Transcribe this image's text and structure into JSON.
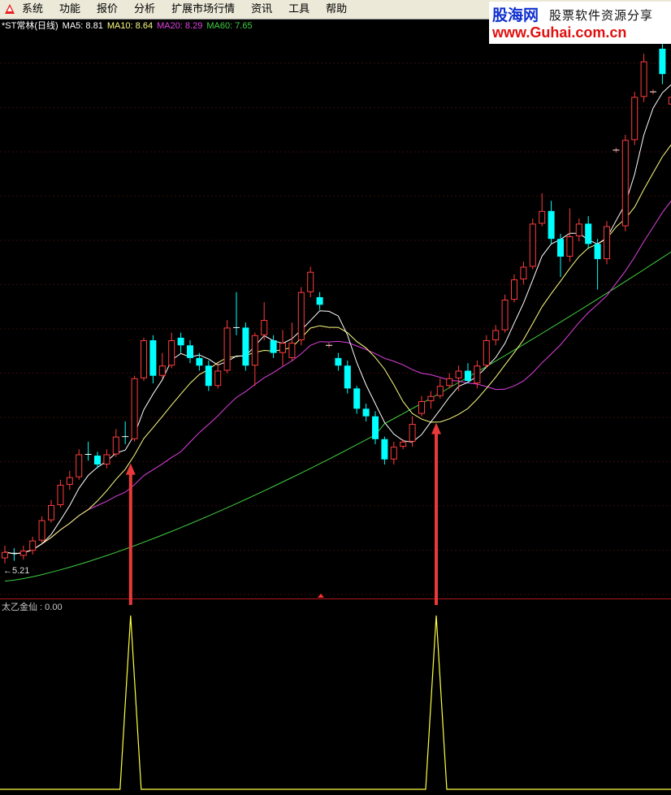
{
  "menubar": {
    "items": [
      "系统",
      "功能",
      "报价",
      "分析",
      "扩展市场行情",
      "资讯",
      "工具",
      "帮助"
    ]
  },
  "brand": {
    "name": "股海网",
    "tagline": "股票软件资源分享",
    "url": "www.Guhai.com.cn"
  },
  "legend": {
    "title": "*ST常林(日线)",
    "ma5": "MA5: 8.81",
    "ma10": "MA10: 8.64",
    "ma20": "MA20: 8.29",
    "ma60": "MA60: 7.65"
  },
  "colors": {
    "up": "#ff3d3d",
    "down": "#00ffff",
    "ma5": "#ffffff",
    "ma10": "#ffff80",
    "ma20": "#e040e0",
    "ma60": "#40d040",
    "signal": "#ffff40",
    "arrow": "#e83a3a"
  },
  "price_low_label": "5.21",
  "indicator": {
    "label": "太乙金仙 : 0.00",
    "value": 0.0
  },
  "chart_data": {
    "type": "candlestick",
    "title": "*ST常林(日线)",
    "y_range_visible": [
      5.0,
      9.3
    ],
    "lowest_marked": 5.21,
    "moving_averages": [
      {
        "name": "MA5",
        "last": 8.81
      },
      {
        "name": "MA10",
        "last": 8.64
      },
      {
        "name": "MA20",
        "last": 8.29
      },
      {
        "name": "MA60",
        "last": 7.65
      }
    ],
    "candles": [
      [
        5.28,
        5.33,
        5.38,
        5.24
      ],
      [
        5.32,
        5.3,
        5.36,
        5.26
      ],
      [
        5.3,
        5.34,
        5.38,
        5.27
      ],
      [
        5.34,
        5.42,
        5.45,
        5.31
      ],
      [
        5.42,
        5.58,
        5.61,
        5.4
      ],
      [
        5.58,
        5.7,
        5.74,
        5.56
      ],
      [
        5.7,
        5.86,
        5.9,
        5.68
      ],
      [
        5.86,
        5.92,
        5.97,
        5.82
      ],
      [
        5.92,
        6.1,
        6.14,
        5.9
      ],
      [
        6.1,
        6.09,
        6.2,
        6.05
      ],
      [
        6.09,
        6.02,
        6.12,
        5.99
      ],
      [
        6.02,
        6.1,
        6.14,
        5.99
      ],
      [
        6.1,
        6.24,
        6.3,
        6.08
      ],
      [
        6.24,
        6.22,
        6.36,
        6.18
      ],
      [
        6.22,
        6.7,
        6.72,
        6.2
      ],
      [
        6.7,
        7.0,
        7.02,
        6.68
      ],
      [
        7.0,
        6.72,
        7.04,
        6.66
      ],
      [
        6.72,
        6.8,
        6.9,
        6.7
      ],
      [
        6.8,
        7.0,
        7.06,
        6.78
      ],
      [
        7.02,
        6.96,
        7.06,
        6.9
      ],
      [
        6.96,
        6.86,
        7.0,
        6.82
      ],
      [
        6.86,
        6.8,
        6.9,
        6.76
      ],
      [
        6.8,
        6.64,
        6.84,
        6.6
      ],
      [
        6.64,
        6.76,
        6.82,
        6.62
      ],
      [
        6.76,
        7.1,
        7.16,
        6.74
      ],
      [
        7.1,
        7.08,
        7.38,
        7.04
      ],
      [
        7.1,
        6.8,
        7.14,
        6.76
      ],
      [
        6.8,
        7.04,
        7.06,
        6.64
      ],
      [
        7.04,
        7.16,
        7.3,
        7.0
      ],
      [
        7.0,
        6.9,
        7.04,
        6.86
      ],
      [
        6.9,
        6.98,
        7.08,
        6.8
      ],
      [
        6.86,
        6.98,
        7.14,
        6.84
      ],
      [
        7.0,
        7.38,
        7.42,
        6.96
      ],
      [
        7.38,
        7.54,
        7.58,
        7.34
      ],
      [
        7.34,
        7.28,
        7.38,
        7.24
      ],
      [
        6.96,
        6.96,
        6.98,
        6.94
      ],
      [
        6.86,
        6.8,
        6.9,
        6.76
      ],
      [
        6.8,
        6.62,
        6.84,
        6.58
      ],
      [
        6.62,
        6.46,
        6.64,
        6.42
      ],
      [
        6.46,
        6.4,
        6.5,
        6.36
      ],
      [
        6.4,
        6.22,
        6.44,
        6.18
      ],
      [
        6.22,
        6.06,
        6.24,
        6.02
      ],
      [
        6.06,
        6.16,
        6.2,
        6.02
      ],
      [
        6.16,
        6.2,
        6.22,
        6.14
      ],
      [
        6.2,
        6.34,
        6.4,
        6.16
      ],
      [
        6.42,
        6.52,
        6.56,
        6.4
      ],
      [
        6.52,
        6.56,
        6.6,
        6.46
      ],
      [
        6.56,
        6.64,
        6.7,
        6.54
      ],
      [
        6.64,
        6.7,
        6.74,
        6.62
      ],
      [
        6.7,
        6.76,
        6.8,
        6.6
      ],
      [
        6.76,
        6.68,
        6.82,
        6.66
      ],
      [
        6.66,
        6.8,
        6.84,
        6.62
      ],
      [
        6.8,
        7.0,
        7.04,
        6.78
      ],
      [
        7.0,
        7.08,
        7.12,
        6.96
      ],
      [
        7.08,
        7.32,
        7.36,
        7.06
      ],
      [
        7.32,
        7.48,
        7.52,
        7.3
      ],
      [
        7.48,
        7.58,
        7.62,
        7.44
      ],
      [
        7.58,
        7.92,
        7.96,
        7.56
      ],
      [
        7.92,
        8.02,
        8.16,
        7.9
      ],
      [
        8.02,
        7.8,
        8.1,
        7.76
      ],
      [
        7.8,
        7.66,
        7.84,
        7.5
      ],
      [
        7.66,
        7.82,
        8.04,
        7.62
      ],
      [
        7.82,
        7.92,
        7.96,
        7.78
      ],
      [
        7.92,
        7.76,
        7.98,
        7.72
      ],
      [
        7.76,
        7.64,
        7.8,
        7.4
      ],
      [
        7.64,
        7.9,
        7.94,
        7.6
      ],
      [
        8.5,
        8.5,
        8.52,
        8.48
      ],
      [
        7.9,
        8.58,
        8.62,
        7.86
      ],
      [
        8.58,
        8.92,
        8.96,
        8.54
      ],
      [
        8.92,
        9.2,
        9.26,
        8.88
      ],
      [
        8.96,
        8.96,
        8.98,
        8.94
      ],
      [
        9.3,
        9.1,
        9.34,
        9.02
      ],
      [
        8.86,
        8.92,
        9.02,
        8.84
      ]
    ],
    "signals": [
      {
        "bar": 12,
        "value": 1
      },
      {
        "bar": 45,
        "value": 1
      }
    ]
  }
}
